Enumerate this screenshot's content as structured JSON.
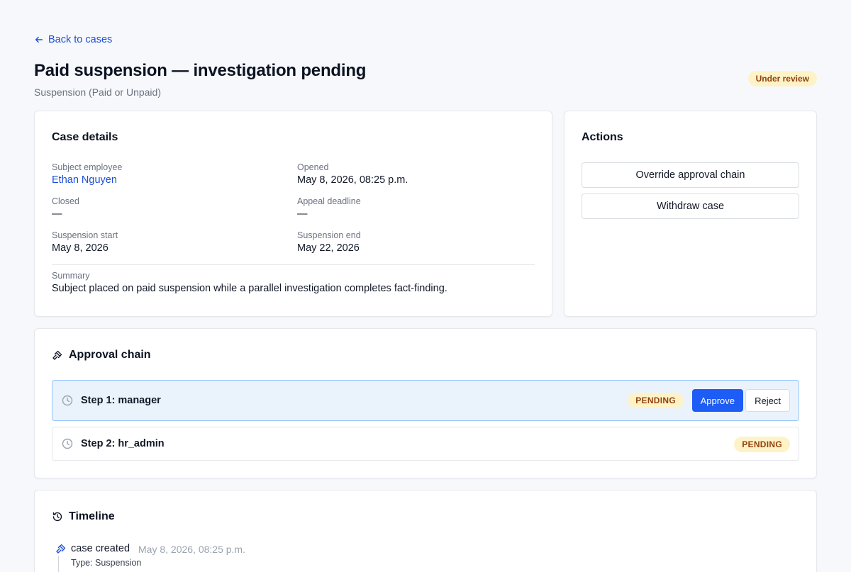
{
  "nav": {
    "back_label": "Back to cases"
  },
  "header": {
    "title": "Paid suspension — investigation pending",
    "subtitle": "Suspension (Paid or Unpaid)",
    "status": "Under review"
  },
  "case_details": {
    "title": "Case details",
    "subject_employee": {
      "label": "Subject employee",
      "value": "Ethan Nguyen"
    },
    "opened": {
      "label": "Opened",
      "value": "May 8, 2026, 08:25 p.m."
    },
    "closed": {
      "label": "Closed",
      "value": "—"
    },
    "appeal_deadline": {
      "label": "Appeal deadline",
      "value": "—"
    },
    "suspension_start": {
      "label": "Suspension start",
      "value": "May 8, 2026"
    },
    "suspension_end": {
      "label": "Suspension end",
      "value": "May 22, 2026"
    },
    "summary": {
      "label": "Summary",
      "value": "Subject placed on paid suspension while a parallel investigation completes fact-finding."
    }
  },
  "actions": {
    "title": "Actions",
    "items": [
      {
        "label": "Override approval chain"
      },
      {
        "label": "Withdraw case"
      }
    ]
  },
  "approval_chain": {
    "title": "Approval chain",
    "steps": [
      {
        "label": "Step 1: manager",
        "status": "PENDING",
        "approve_label": "Approve",
        "reject_label": "Reject",
        "active": true
      },
      {
        "label": "Step 2: hr_admin",
        "status": "PENDING",
        "active": false
      }
    ]
  },
  "timeline": {
    "title": "Timeline",
    "events": [
      {
        "event": "case created",
        "time": "May 8, 2026, 08:25 p.m.",
        "detail": "Type: Suspension"
      }
    ]
  },
  "colors": {
    "accent": "#1d4ed8",
    "primary_button": "#1d5cf5",
    "pending_bg": "#fef3c7",
    "pending_text": "#92400e",
    "active_step_bg": "#eaf3fc"
  },
  "icons": {
    "back": "arrow-left-icon",
    "approval": "gavel-icon",
    "step": "clock-icon",
    "timeline": "history-icon",
    "event": "gavel-icon"
  }
}
